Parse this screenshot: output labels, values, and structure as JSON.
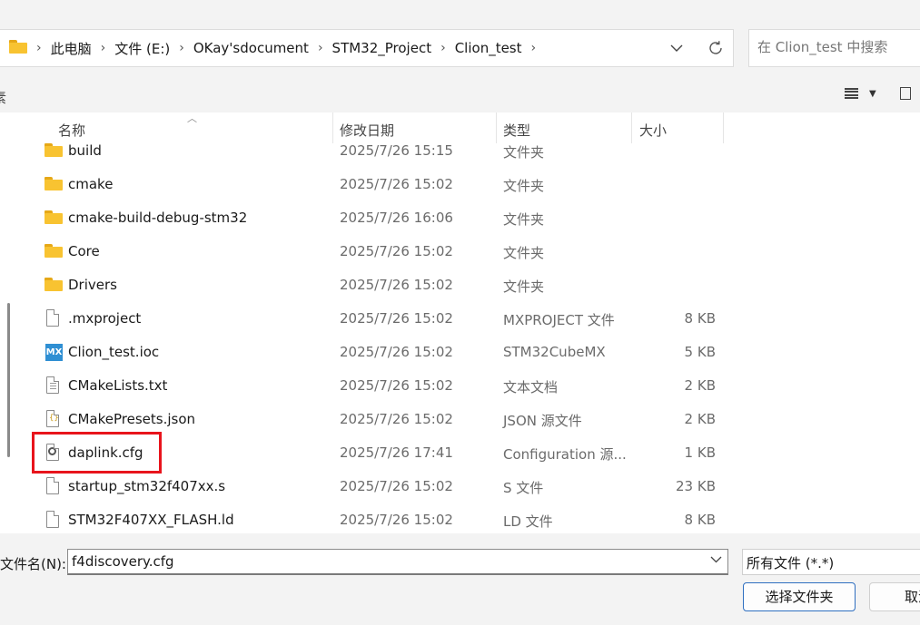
{
  "breadcrumb": [
    "此电脑",
    "文件 (E:)",
    "OKay'sdocument",
    "STM32_Project",
    "Clion_test"
  ],
  "search": {
    "placeholder": "在 Clion_test 中搜索"
  },
  "toolbar": {
    "left_fragment": "素"
  },
  "columns": {
    "name": "名称",
    "date": "修改日期",
    "type": "类型",
    "size": "大小"
  },
  "files": [
    {
      "name": "build",
      "date": "2025/7/26 15:15",
      "type": "文件夹",
      "size": "",
      "icon": "folder-icon"
    },
    {
      "name": "cmake",
      "date": "2025/7/26 15:02",
      "type": "文件夹",
      "size": "",
      "icon": "folder-icon"
    },
    {
      "name": "cmake-build-debug-stm32",
      "date": "2025/7/26 16:06",
      "type": "文件夹",
      "size": "",
      "icon": "folder-icon"
    },
    {
      "name": "Core",
      "date": "2025/7/26 15:02",
      "type": "文件夹",
      "size": "",
      "icon": "folder-icon"
    },
    {
      "name": "Drivers",
      "date": "2025/7/26 15:02",
      "type": "文件夹",
      "size": "",
      "icon": "folder-icon"
    },
    {
      "name": ".mxproject",
      "date": "2025/7/26 15:02",
      "type": "MXPROJECT 文件",
      "size": "8 KB",
      "icon": "blank-file-icon"
    },
    {
      "name": "Clion_test.ioc",
      "date": "2025/7/26 15:02",
      "type": "STM32CubeMX",
      "size": "5 KB",
      "icon": "stm32cubemx-icon",
      "icon_label": "MX"
    },
    {
      "name": "CMakeLists.txt",
      "date": "2025/7/26 15:02",
      "type": "文本文档",
      "size": "2 KB",
      "icon": "text-file-icon"
    },
    {
      "name": "CMakePresets.json",
      "date": "2025/7/26 15:02",
      "type": "JSON 源文件",
      "size": "2 KB",
      "icon": "json-file-icon"
    },
    {
      "name": "daplink.cfg",
      "date": "2025/7/26 17:41",
      "type": "Configuration 源...",
      "size": "1 KB",
      "icon": "config-file-icon"
    },
    {
      "name": "startup_stm32f407xx.s",
      "date": "2025/7/26 15:02",
      "type": "S 文件",
      "size": "23 KB",
      "icon": "blank-file-icon"
    },
    {
      "name": "STM32F407XX_FLASH.ld",
      "date": "2025/7/26 15:02",
      "type": "LD 文件",
      "size": "8 KB",
      "icon": "blank-file-icon"
    }
  ],
  "footer": {
    "filename_label": "文件名(N):",
    "filename_value": "f4discovery.cfg",
    "filter_value": "所有文件 (*.*)",
    "select_button": "选择文件夹",
    "cancel_button": "取消"
  },
  "colors": {
    "folder": "#f8c331",
    "highlight": "#e8141c",
    "primary_border": "#2f6fc0"
  }
}
